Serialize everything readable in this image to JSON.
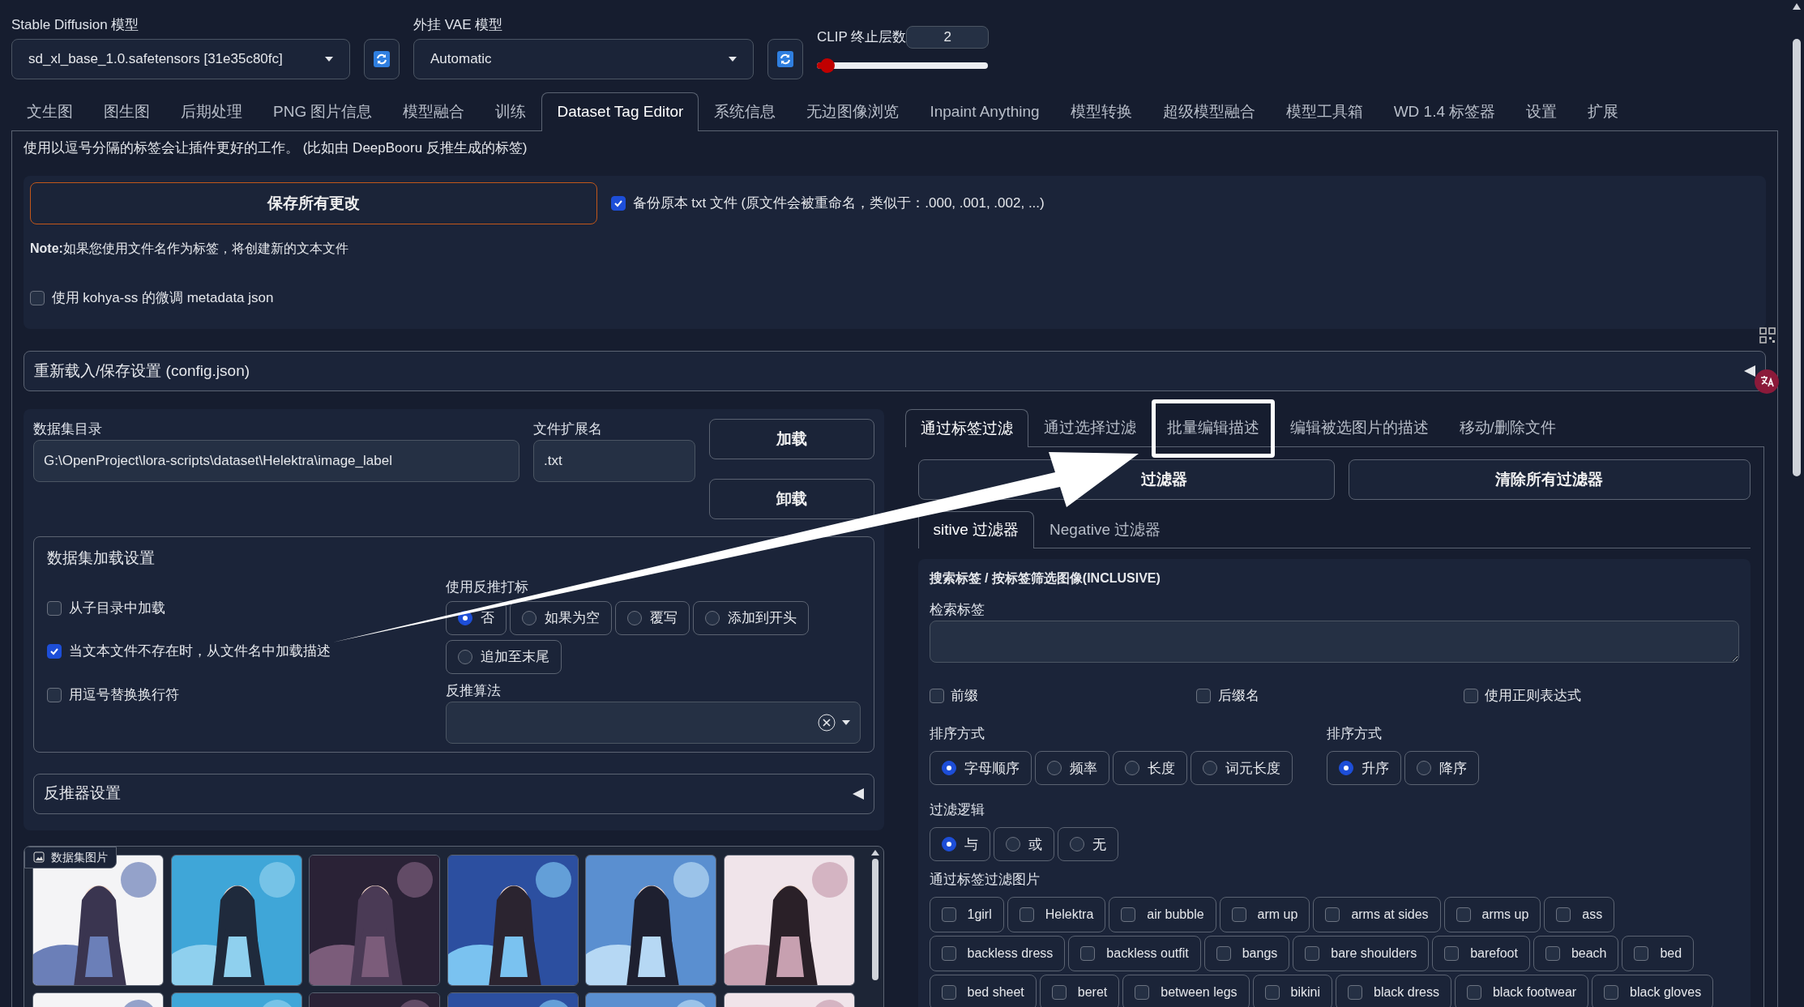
{
  "top_bar": {
    "sd_model": {
      "label": "Stable Diffusion 模型",
      "value": "sd_xl_base_1.0.safetensors [31e35c80fc]"
    },
    "vae": {
      "label": "外挂 VAE 模型",
      "value": "Automatic"
    },
    "clip": {
      "label": "CLIP 终止层数",
      "value": "2",
      "level": 0.06
    }
  },
  "tabs": [
    {
      "label": "文生图",
      "selected": false
    },
    {
      "label": "图生图",
      "selected": false
    },
    {
      "label": "后期处理",
      "selected": false
    },
    {
      "label": "PNG 图片信息",
      "selected": false
    },
    {
      "label": "模型融合",
      "selected": false
    },
    {
      "label": "训练",
      "selected": false
    },
    {
      "label": "Dataset Tag Editor",
      "selected": true
    },
    {
      "label": "系统信息",
      "selected": false
    },
    {
      "label": "无边图像浏览",
      "selected": false
    },
    {
      "label": "Inpaint Anything",
      "selected": false
    },
    {
      "label": "模型转换",
      "selected": false
    },
    {
      "label": "超级模型融合",
      "selected": false
    },
    {
      "label": "模型工具箱",
      "selected": false
    },
    {
      "label": "WD 1.4 标签器",
      "selected": false
    },
    {
      "label": "设置",
      "selected": false
    },
    {
      "label": "扩展",
      "selected": false
    }
  ],
  "info_text": "使用以逗号分隔的标签会让插件更好的工作。 (比如由 DeepBooru 反推生成的标签)",
  "save_panel": {
    "save_button": "保存所有更改",
    "backup": {
      "label": "备份原本 txt 文件 (原文件会被重命名，类似于：.000, .001, .002, ...)",
      "checked": true
    },
    "note": "**Note:**如果您使用文件名作为标签，将创建新的文本文件",
    "kohya": {
      "label": "使用 kohya-ss 的微调 metadata json",
      "checked": false
    }
  },
  "config_accordion": {
    "title": "重新载入/保存设置 (config.json)",
    "expanded": false
  },
  "dataset": {
    "dir_label": "数据集目录",
    "dir_value": "G:\\OpenProject\\lora-scripts\\dataset\\Helektra\\image_label",
    "ext_label": "文件扩展名",
    "ext_value": ".txt",
    "buttons": [
      "加载",
      "卸载"
    ]
  },
  "load_settings": {
    "title": "数据集加载设置",
    "checkboxes": [
      {
        "label": "从子目录中加载",
        "checked": false
      },
      {
        "label": "当文本文件不存在时，从文件名中加载描述",
        "checked": true
      },
      {
        "label": "用逗号替换换行符",
        "checked": false
      }
    ],
    "interrogate": {
      "label": "使用反推打标",
      "options": [
        {
          "label": "否",
          "selected": true
        },
        {
          "label": "如果为空",
          "selected": false
        },
        {
          "label": "覆写",
          "selected": false
        },
        {
          "label": "添加到开头",
          "selected": false
        },
        {
          "label": "追加至末尾",
          "selected": false
        }
      ]
    },
    "algorithm": {
      "label": "反推算法"
    }
  },
  "interrogator_accordion": {
    "title": "反推器设置",
    "expanded": false
  },
  "gallery": {
    "label": "数据集图片"
  },
  "filter_tabs": [
    {
      "label": "通过标签过滤",
      "selected": true,
      "highlighted": false
    },
    {
      "label": "通过选择过滤",
      "selected": false,
      "highlighted": false
    },
    {
      "label": "批量编辑描述",
      "selected": false,
      "highlighted": true
    },
    {
      "label": "编辑被选图片的描述",
      "selected": false,
      "highlighted": false
    },
    {
      "label": "移动/删除文件",
      "selected": false,
      "highlighted": false
    }
  ],
  "filter_buttons": [
    "过滤器",
    "清除所有过滤器"
  ],
  "filter_subtabs": [
    {
      "label": "sitive 过滤器",
      "selected": true
    },
    {
      "label": "Negative 过滤器",
      "selected": false
    }
  ],
  "tag_filter": {
    "title": "搜索标签 / 按标签筛选图像(INCLUSIVE)",
    "search_label": "检索标签",
    "options": [
      {
        "label": "前缀",
        "checked": false
      },
      {
        "label": "后缀名",
        "checked": false
      },
      {
        "label": "使用正则表达式",
        "checked": false
      }
    ],
    "sort_by": {
      "label": "排序方式",
      "options": [
        {
          "label": "字母顺序",
          "selected": true
        },
        {
          "label": "频率",
          "selected": false
        },
        {
          "label": "长度",
          "selected": false
        },
        {
          "label": "词元长度",
          "selected": false
        }
      ]
    },
    "sort_order": {
      "label": "排序方式",
      "options": [
        {
          "label": "升序",
          "selected": true
        },
        {
          "label": "降序",
          "selected": false
        }
      ]
    },
    "logic": {
      "label": "过滤逻辑",
      "options": [
        {
          "label": "与",
          "selected": true
        },
        {
          "label": "或",
          "selected": false
        },
        {
          "label": "无",
          "selected": false
        }
      ]
    },
    "tags_label": "通过标签过滤图片",
    "tags": [
      {
        "label": "1girl",
        "checked": false
      },
      {
        "label": "Helektra",
        "checked": false
      },
      {
        "label": "air bubble",
        "checked": false
      },
      {
        "label": "arm up",
        "checked": false
      },
      {
        "label": "arms at sides",
        "checked": false
      },
      {
        "label": "arms up",
        "checked": false
      },
      {
        "label": "ass",
        "checked": false
      },
      {
        "label": "backless dress",
        "checked": false
      },
      {
        "label": "backless outfit",
        "checked": false
      },
      {
        "label": "bangs",
        "checked": false
      },
      {
        "label": "bare shoulders",
        "checked": false
      },
      {
        "label": "barefoot",
        "checked": false
      },
      {
        "label": "beach",
        "checked": false
      },
      {
        "label": "bed",
        "checked": false
      },
      {
        "label": "bed sheet",
        "checked": false
      },
      {
        "label": "beret",
        "checked": false
      },
      {
        "label": "between legs",
        "checked": false
      },
      {
        "label": "bikini",
        "checked": false
      },
      {
        "label": "black dress",
        "checked": false
      },
      {
        "label": "black footwear",
        "checked": false
      },
      {
        "label": "black gloves",
        "checked": false
      }
    ]
  }
}
